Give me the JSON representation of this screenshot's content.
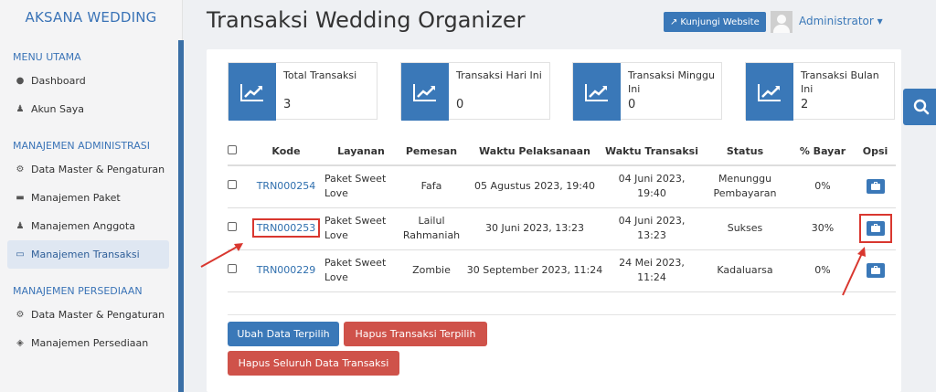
{
  "sidebar": {
    "brand": "AKSANA WEDDING",
    "sections": [
      {
        "title": "MENU UTAMA",
        "items": [
          {
            "label": "Dashboard",
            "icon": "globe-icon"
          },
          {
            "label": "Akun Saya",
            "icon": "user-icon"
          }
        ]
      },
      {
        "title": "MANAJEMEN ADMINISTRASI",
        "items": [
          {
            "label": "Data Master & Pengaturan",
            "icon": "cogs-icon"
          },
          {
            "label": "Manajemen Paket",
            "icon": "book-icon"
          },
          {
            "label": "Manajemen Anggota",
            "icon": "users-icon"
          },
          {
            "label": "Manajemen Transaksi",
            "icon": "cart-icon",
            "active": true
          }
        ]
      },
      {
        "title": "MANAJEMEN PERSEDIAAN",
        "items": [
          {
            "label": "Data Master & Pengaturan",
            "icon": "cogs-icon"
          },
          {
            "label": "Manajemen Persediaan",
            "icon": "cubes-icon"
          }
        ]
      }
    ]
  },
  "header": {
    "title": "Transaksi Wedding Organizer",
    "website_button": "Kunjungi Website",
    "user": "Administrator"
  },
  "stats": [
    {
      "label": "Total Transaksi",
      "value": "3"
    },
    {
      "label": "Transaksi Hari Ini",
      "value": "0"
    },
    {
      "label": "Transaksi Minggu Ini",
      "value": "0"
    },
    {
      "label": "Transaksi Bulan Ini",
      "value": "2"
    }
  ],
  "table": {
    "headers": [
      "Kode",
      "Layanan",
      "Pemesan",
      "Waktu Pelaksanaan",
      "Waktu Transaksi",
      "Status",
      "% Bayar",
      "Opsi"
    ],
    "rows": [
      {
        "kode": "TRN000254",
        "layanan": "Paket Sweet Love",
        "pemesan": "Fafa",
        "waktu_pelaksanaan": "05 Agustus 2023, 19:40",
        "waktu_transaksi": "04 Juni 2023, 19:40",
        "status": "Menunggu Pembayaran",
        "bayar": "0%"
      },
      {
        "kode": "TRN000253",
        "layanan": "Paket Sweet Love",
        "pemesan": "Lailul Rahmaniah",
        "waktu_pelaksanaan": "30 Juni 2023, 13:23",
        "waktu_transaksi": "04 Juni 2023, 13:23",
        "status": "Sukses",
        "bayar": "30%"
      },
      {
        "kode": "TRN000229",
        "layanan": "Paket Sweet Love",
        "pemesan": "Zombie",
        "waktu_pelaksanaan": "30 September 2023, 11:24",
        "waktu_transaksi": "24 Mei 2023, 11:24",
        "status": "Kadaluarsa",
        "bayar": "0%"
      }
    ]
  },
  "actions": {
    "update_selected": "Ubah Data Terpilih",
    "delete_selected": "Hapus Transaksi Terpilih",
    "delete_all": "Hapus Seluruh Data Transaksi"
  },
  "colors": {
    "primary": "#3a78b8",
    "danger": "#cf524a",
    "annotation": "#d9372f"
  }
}
